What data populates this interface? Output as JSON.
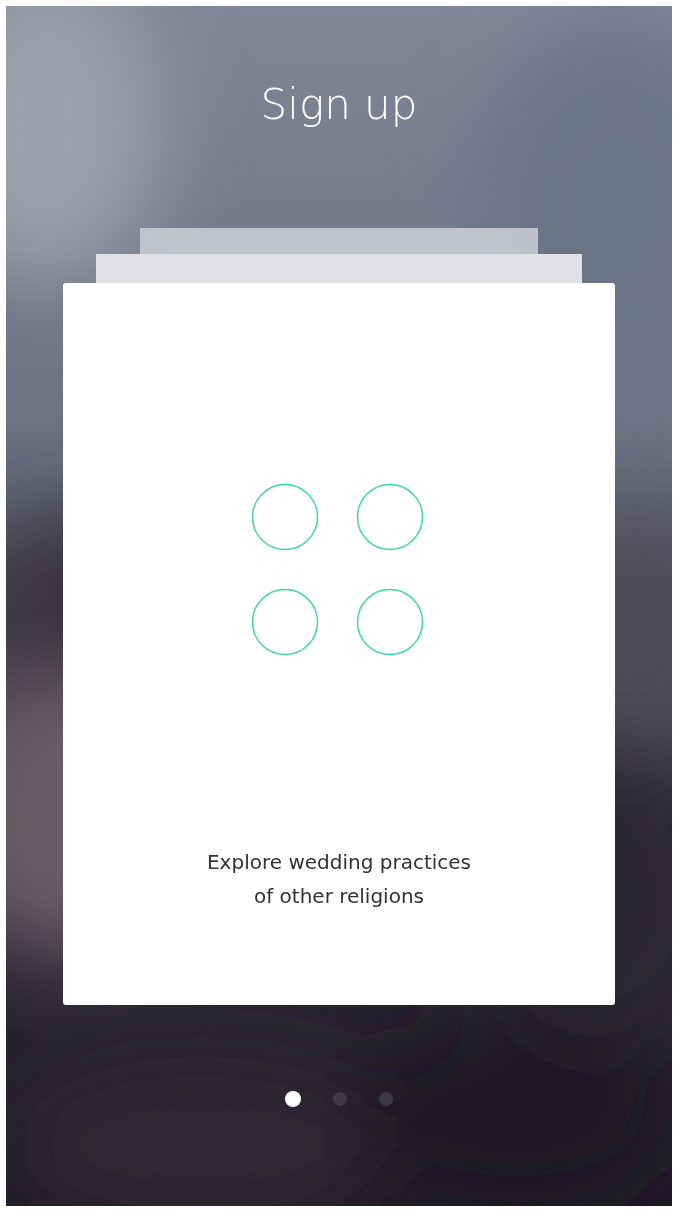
{
  "title": "Sign up",
  "card": {
    "text": "Explore wedding practices\nof other religions"
  },
  "pager": [
    {
      "selected": true
    },
    {
      "selected": false
    },
    {
      "selected": false
    }
  ]
}
